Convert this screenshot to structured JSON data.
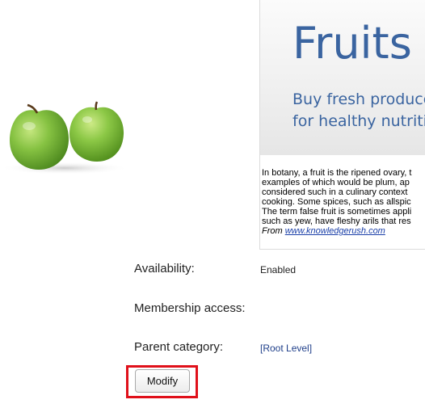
{
  "banner": {
    "title": "Fruits",
    "subtitle_line1": "Buy fresh produce",
    "subtitle_line2": "for healthy nutritio"
  },
  "description": {
    "lines": [
      "In botany, a fruit is the ripened ovary, t",
      "examples of which would be plum, ap",
      "considered such in a culinary context",
      "cooking. Some spices, such as allspic",
      "The term false fruit is sometimes appli",
      "such as yew, have fleshy arils that res"
    ],
    "from_label": "From",
    "source_link": "www.knowledgerush.com"
  },
  "properties": {
    "availability_label": "Availability:",
    "availability_value": "Enabled",
    "membership_label": "Membership access:",
    "membership_value": "",
    "parent_label": "Parent category:",
    "parent_value": "[Root Level]"
  },
  "actions": {
    "modify_label": "Modify"
  },
  "colors": {
    "banner_text": "#3a64a0",
    "link": "#1a3fa8",
    "highlight": "#e0101a",
    "apple_green": "#7bc142"
  },
  "image": {
    "category_image": "green-apples-photo"
  }
}
